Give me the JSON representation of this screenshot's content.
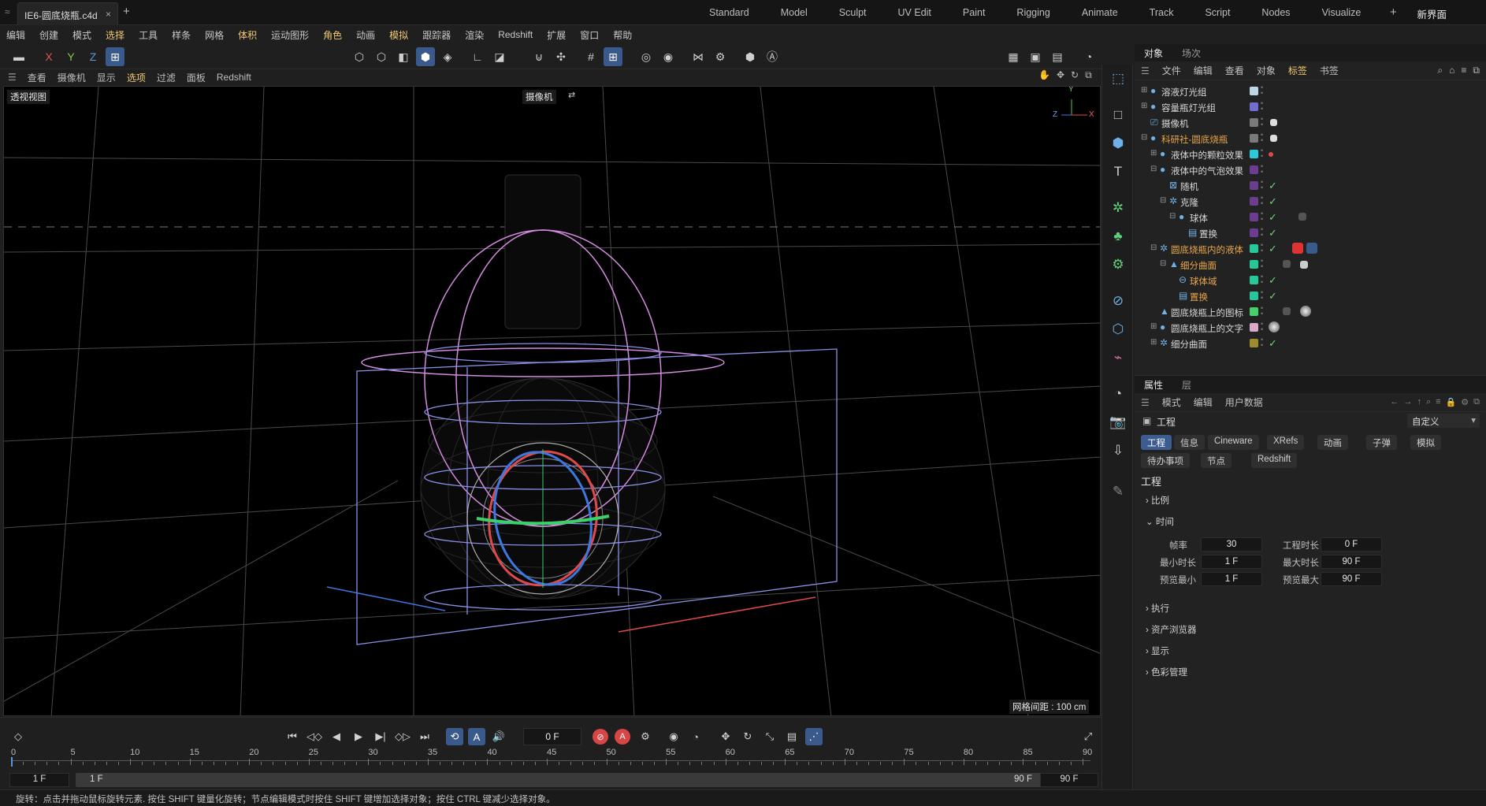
{
  "title_tab": {
    "filename": "IE6-圆底烧瓶.c4d",
    "close": "×",
    "new_tab": "+"
  },
  "layouts": [
    "Standard",
    "Model",
    "Sculpt",
    "UV Edit",
    "Paint",
    "Rigging",
    "Animate",
    "Track",
    "Script",
    "Nodes",
    "Visualize"
  ],
  "layout_add": "+",
  "new_ui": "新界面",
  "menubar": [
    "编辑",
    "创建",
    "模式",
    "选择",
    "工具",
    "样条",
    "网格",
    "体积",
    "运动图形",
    "角色",
    "动画",
    "模拟",
    "跟踪器",
    "渲染",
    "Redshift",
    "扩展",
    "窗口",
    "帮助"
  ],
  "toolbar": {
    "x_label": "X",
    "y_label": "Y",
    "z_label": "Z"
  },
  "viewport_menu": [
    "查看",
    "摄像机",
    "显示",
    "选项",
    "过滤",
    "面板",
    "Redshift"
  ],
  "viewport": {
    "view_name": "透视视图",
    "camera_label": "摄像机",
    "grid_spacing": "网格间距 : 100 cm",
    "axis_y": "Y",
    "axis_z": "Z",
    "axis_x": "X"
  },
  "object_panel": {
    "tabs": [
      "对象",
      "场次"
    ],
    "menu": [
      "文件",
      "编辑",
      "查看",
      "对象",
      "标签",
      "书签"
    ],
    "objects": [
      {
        "name": "溶液灯光组",
        "color": "#bcd7e3"
      },
      {
        "name": "容量瓶灯光组",
        "color": "#6f6fcf"
      },
      {
        "name": "摄像机",
        "color": "#7a7a7a"
      },
      {
        "name": "科研社-圆底烧瓶",
        "color": "#7a7a7a"
      },
      {
        "name": "液体中的颗粒效果",
        "color": "#2ec9d9"
      },
      {
        "name": "液体中的气泡效果",
        "color": "#6c3c8f"
      },
      {
        "name": "随机",
        "color": "#6c3c8f"
      },
      {
        "name": "克隆",
        "color": "#6c3c8f"
      },
      {
        "name": "球体",
        "color": "#6c3c8f"
      },
      {
        "name": "置换",
        "color": "#6c3c8f"
      },
      {
        "name": "圆底烧瓶内的液体",
        "color": "#27c79a"
      },
      {
        "name": "细分曲面",
        "color": "#27c79a"
      },
      {
        "name": "球体域",
        "color": "#27c79a"
      },
      {
        "name": "置换",
        "color": "#27c79a"
      },
      {
        "name": "圆底烧瓶上的图标",
        "color": "#45d06a"
      },
      {
        "name": "圆底烧瓶上的文字",
        "color": "#d9a9c9"
      },
      {
        "name": "细分曲面",
        "color": "#a08a2e"
      }
    ]
  },
  "attr_panel": {
    "tabs": [
      "属性",
      "层"
    ],
    "menu": [
      "模式",
      "编辑",
      "用户数据"
    ],
    "header": "工程",
    "preset": "自定义",
    "pills_row1": [
      "工程",
      "信息",
      "Cineware",
      "XRefs",
      "动画",
      "子弹",
      "模拟"
    ],
    "pills_row2": [
      "待办事项",
      "节点",
      "Redshift"
    ],
    "section_title": "工程",
    "groups": [
      "比例",
      "时间",
      "执行",
      "资产浏览器",
      "显示",
      "色彩管理"
    ],
    "time": {
      "fps_label": "帧率",
      "fps": "30",
      "proj_len_label": "工程时长",
      "proj_len": "0 F",
      "min_label": "最小时长",
      "min": "1 F",
      "max_label": "最大时长",
      "max": "90 F",
      "prev_min_label": "预览最小",
      "prev_min": "1 F",
      "prev_max_label": "预览最大",
      "prev_max": "90 F"
    }
  },
  "timeline": {
    "current_frame": "0 F",
    "ruler": [
      "0",
      "5",
      "10",
      "15",
      "20",
      "25",
      "30",
      "35",
      "40",
      "45",
      "50",
      "55",
      "60",
      "65",
      "70",
      "75",
      "80",
      "85",
      "90"
    ],
    "start": "1 F",
    "range_start": "1 F",
    "range_end": "90 F",
    "end": "90 F"
  },
  "statusbar": "旋转：点击并拖动鼠标旋转元素. 按住 SHIFT 键量化旋转；节点编辑模式时按住 SHIFT 键增加选择对象；按住 CTRL 键减少选择对象。",
  "colors": {
    "accent": "#3b5a8c",
    "highlight": "#f2c872",
    "orange_obj": "#e8a64a"
  }
}
